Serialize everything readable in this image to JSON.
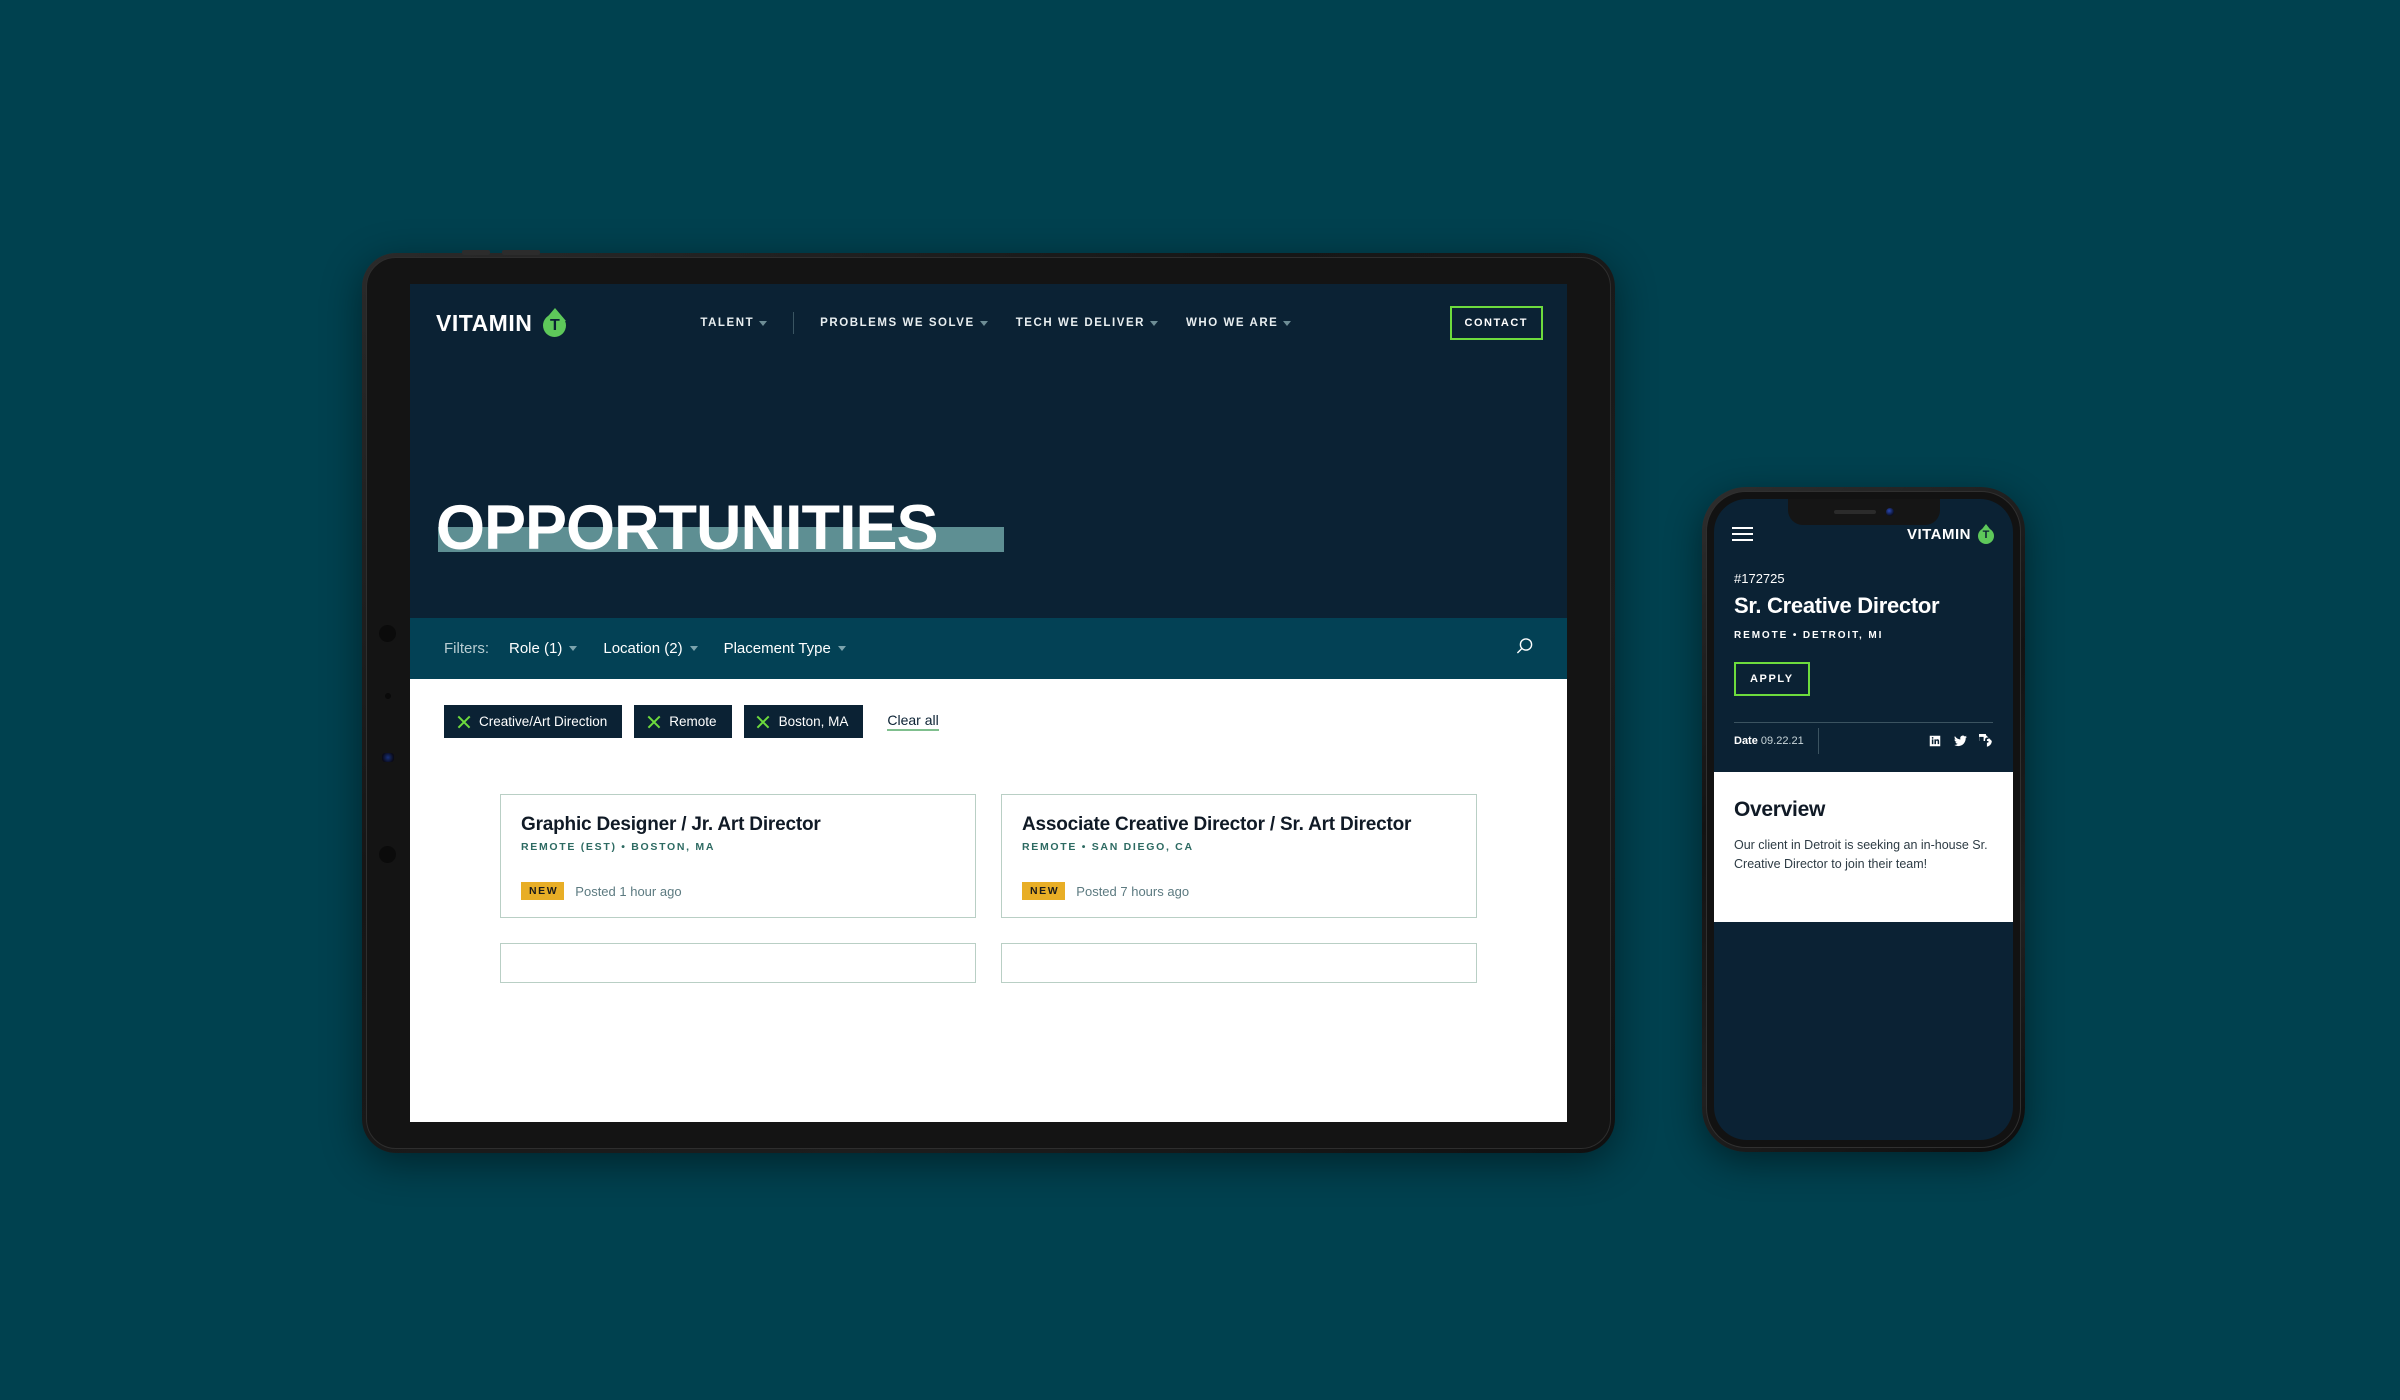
{
  "theme": {
    "page_background": "#00414f",
    "site_dark": "#0b2234",
    "filter_bar": "#034155",
    "accent_green": "#6ddb3d",
    "logo_green": "#5ec85a",
    "highlight_teal": "#5e8f93",
    "badge_yellow": "#e8ae26",
    "card_border": "#b9cfc5"
  },
  "tablet": {
    "header": {
      "logo_word": "VITAMIN",
      "logo_mark_letter": "T",
      "nav": [
        {
          "label": "TALENT",
          "has_caret": true
        },
        {
          "label": "PROBLEMS WE SOLVE",
          "has_caret": true
        },
        {
          "label": "TECH WE DELIVER",
          "has_caret": true
        },
        {
          "label": "WHO WE ARE",
          "has_caret": true
        }
      ],
      "contact_label": "CONTACT"
    },
    "hero": {
      "title": "OPPORTUNITIES"
    },
    "filterbar": {
      "label": "Filters:",
      "dropdowns": [
        {
          "label": "Role (1)"
        },
        {
          "label": "Location (2)"
        },
        {
          "label": "Placement Type"
        }
      ],
      "search_icon": "search-icon"
    },
    "results": {
      "chips": [
        {
          "label": "Creative/Art Direction",
          "remove_icon": "close-icon"
        },
        {
          "label": "Remote",
          "remove_icon": "close-icon"
        },
        {
          "label": "Boston, MA",
          "remove_icon": "close-icon"
        }
      ],
      "clear_all_label": "Clear all",
      "cards": [
        {
          "title": "Graphic Designer / Jr. Art Director",
          "location": "REMOTE (EST) • BOSTON, MA",
          "badge": "NEW",
          "posted": "Posted 1 hour ago"
        },
        {
          "title": "Associate Creative Director / Sr. Art Director",
          "location": "REMOTE • SAN DIEGO, CA",
          "badge": "NEW",
          "posted": "Posted 7 hours ago"
        }
      ]
    }
  },
  "phone": {
    "header": {
      "menu_icon": "hamburger-menu-icon",
      "logo_word": "VITAMIN",
      "logo_mark_letter": "T"
    },
    "job": {
      "id": "#172725",
      "title": "Sr. Creative Director",
      "location": "REMOTE • DETROIT, MI",
      "apply_label": "APPLY",
      "date_label": "Date",
      "date_value": "09.22.21",
      "socials": [
        "linkedin-icon",
        "twitter-icon",
        "facebook-icon"
      ]
    },
    "overview": {
      "heading": "Overview",
      "body": "Our client in Detroit is seeking an in-house Sr. Creative Director to join their team!"
    }
  }
}
